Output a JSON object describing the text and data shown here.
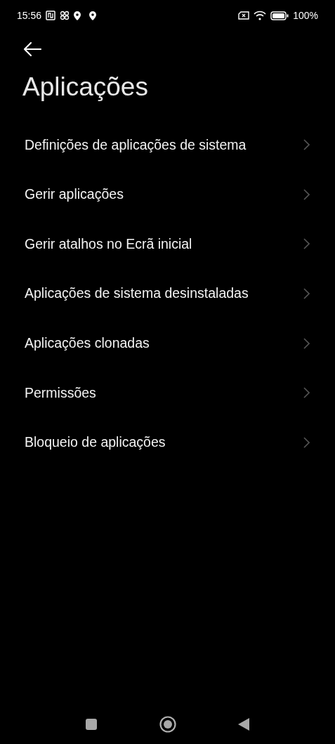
{
  "status_bar": {
    "time": "15:56",
    "battery": "100%"
  },
  "title": "Aplicações",
  "items": [
    {
      "label": "Definições de aplicações de sistema"
    },
    {
      "label": "Gerir aplicações"
    },
    {
      "label": "Gerir atalhos no Ecrã inicial"
    },
    {
      "label": "Aplicações de sistema desinstaladas"
    },
    {
      "label": "Aplicações clonadas"
    },
    {
      "label": "Permissões"
    },
    {
      "label": "Bloqueio de aplicações"
    }
  ]
}
